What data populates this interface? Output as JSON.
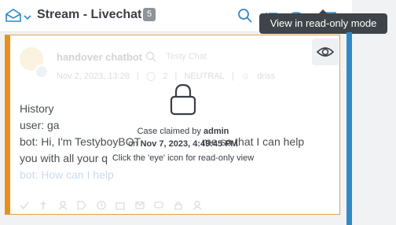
{
  "header": {
    "title": "Stream - Livechat",
    "count": "5"
  },
  "tooltip": "View in read-only mode",
  "card": {
    "name": "handover chatbot",
    "subtitle": "Testy Chat",
    "meta": {
      "date": "Nov 2, 2023, 13:28",
      "comments": "2",
      "sentiment": "NEUTRAL",
      "user": "driss"
    },
    "history": [
      "History",
      "user: ga",
      "bot: Hi, I'm TestyboyBOT",
      "you with all your q",
      "bot: How can I help"
    ],
    "history_tail": "me so that I can help"
  },
  "claim": {
    "prefix": "Case claimed by ",
    "user": "admin",
    "on": "on ",
    "date": "Nov 7, 2023, 4:49:45 PM",
    "hint": "Click the 'eye' icon for read-only view"
  },
  "colors": {
    "accent_orange": "#e8901f",
    "strip_blue": "#2f89c5",
    "link_blue": "#2f89c5"
  }
}
